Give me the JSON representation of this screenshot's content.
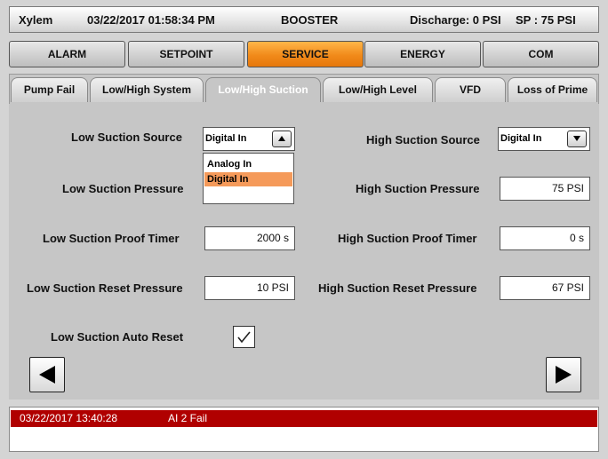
{
  "header": {
    "app": "Xylem",
    "datetime": "03/22/2017 01:58:34 PM",
    "mode": "BOOSTER",
    "discharge": "Discharge: 0 PSI",
    "setpoint": "SP : 75 PSI"
  },
  "top_tabs": [
    {
      "label": "ALARM"
    },
    {
      "label": "SETPOINT"
    },
    {
      "label": "SERVICE",
      "active": true
    },
    {
      "label": "ENERGY"
    },
    {
      "label": "COM"
    }
  ],
  "sub_tabs": [
    {
      "label": "Pump Fail"
    },
    {
      "label": "Low/High System"
    },
    {
      "label": "Low/High Suction",
      "active": true
    },
    {
      "label": "Low/High Level"
    },
    {
      "label": "VFD"
    },
    {
      "label": "Loss of Prime"
    }
  ],
  "low": {
    "source_label": "Low Suction Source",
    "source_value": "Digital In",
    "source_options": [
      "Analog In",
      "Digital In"
    ],
    "source_selected_option": "Digital In",
    "pressure_label": "Low Suction Pressure",
    "proof_timer_label": "Low Suction Proof Timer",
    "proof_timer_value": "2000 s",
    "reset_pressure_label": "Low Suction Reset Pressure",
    "reset_pressure_value": "10 PSI",
    "auto_reset_label": "Low Suction Auto Reset",
    "auto_reset_checked": true
  },
  "high": {
    "source_label": "High Suction Source",
    "source_value": "Digital In",
    "pressure_label": "High Suction Pressure",
    "pressure_value": "75 PSI",
    "proof_timer_label": "High Suction Proof Timer",
    "proof_timer_value": "0 s",
    "reset_pressure_label": "High Suction Reset Pressure",
    "reset_pressure_value": "67 PSI"
  },
  "icons": {
    "prev": "triangle-left-icon",
    "next": "triangle-right-icon",
    "dropdown_open": "triangle-up-icon",
    "dropdown_closed": "triangle-down-icon",
    "check": "check-icon"
  },
  "alarm": {
    "timestamp": "03/22/2017 13:40:28",
    "message": "AI 2 Fail"
  },
  "colors": {
    "active_tab": "#f18a1a",
    "selected_option": "#f59a5a",
    "alarm_row": "#b00000"
  }
}
